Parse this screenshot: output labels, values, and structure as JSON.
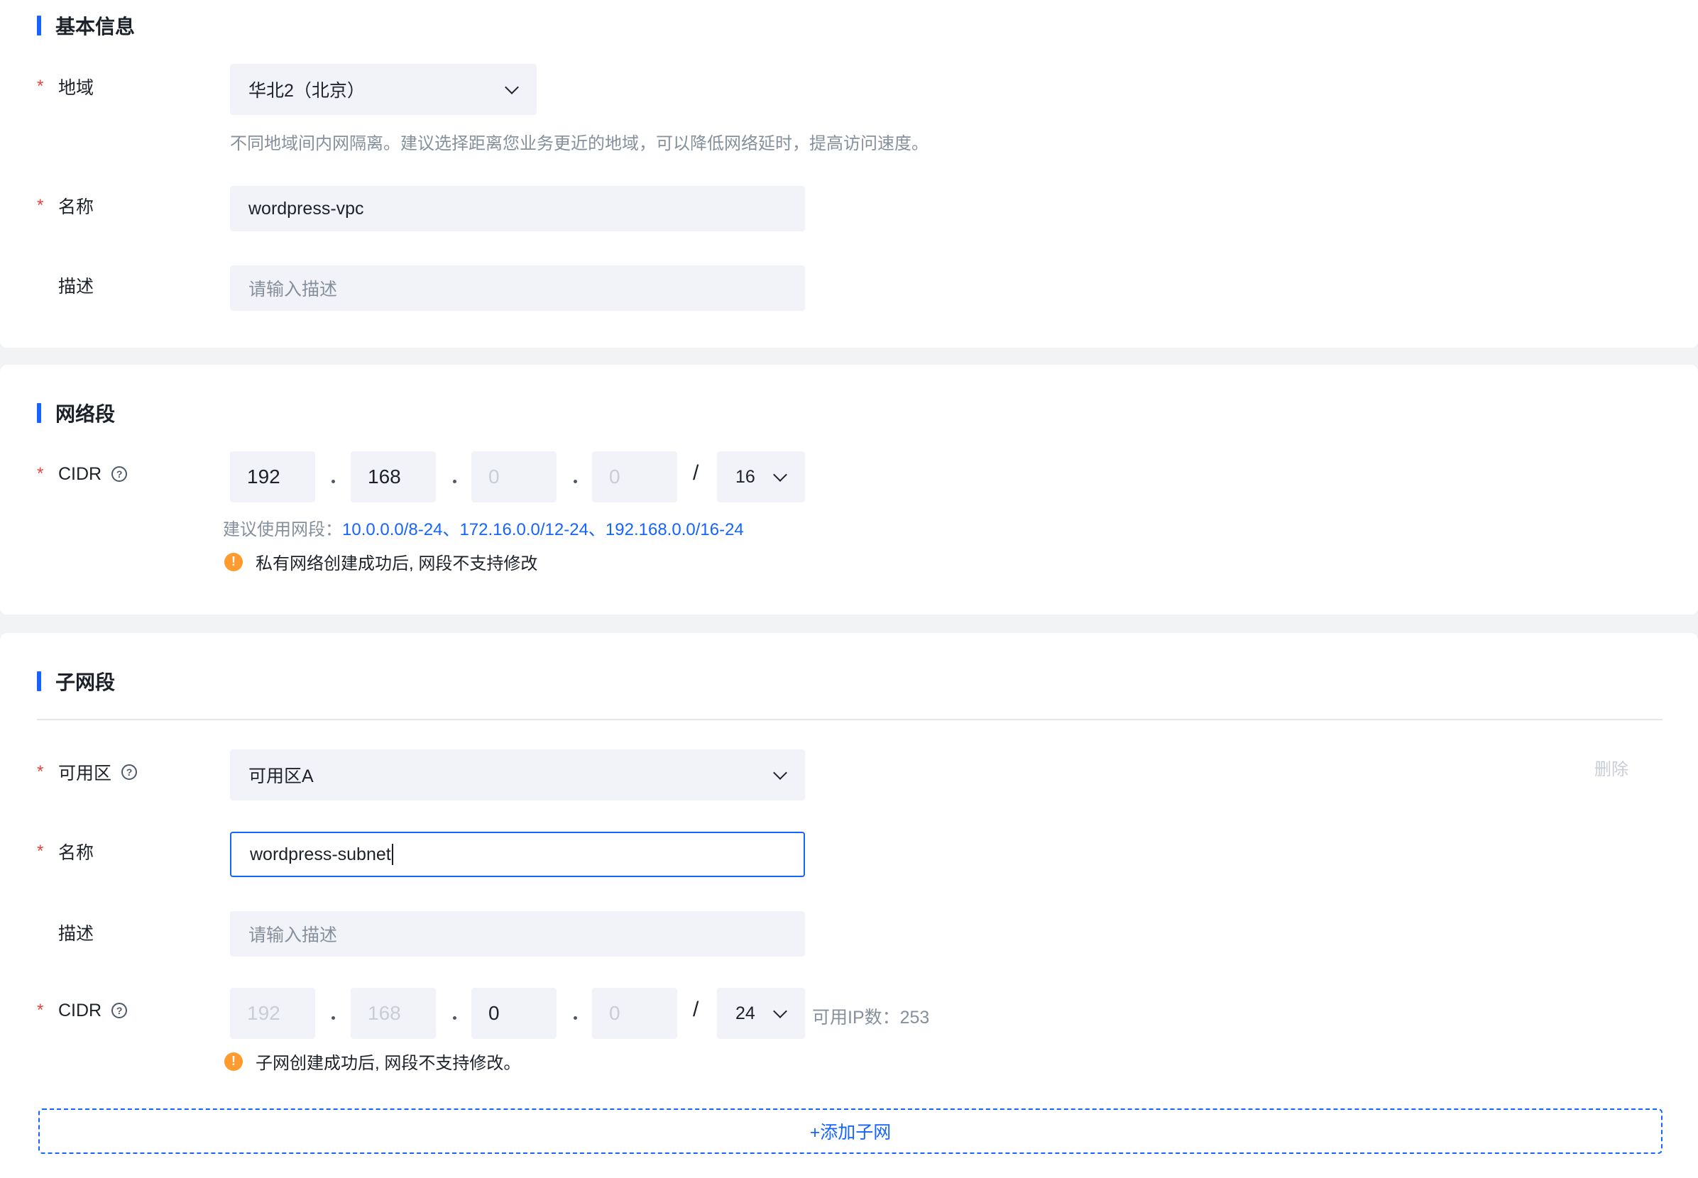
{
  "basic_info": {
    "title": "基本信息",
    "region": {
      "label": "地域",
      "value": "华北2（北京）",
      "hint": "不同地域间内网隔离。建议选择距离您业务更近的地域，可以降低网络延时，提高访问速度。"
    },
    "name": {
      "label": "名称",
      "value": "wordpress-vpc"
    },
    "description": {
      "label": "描述",
      "placeholder": "请输入描述"
    }
  },
  "network": {
    "title": "网络段",
    "cidr": {
      "label": "CIDR",
      "octets": [
        "192",
        "168",
        "0",
        "0"
      ],
      "mask": "16",
      "hint_prefix": "建议使用网段：",
      "hint_ranges": "10.0.0.0/8-24、172.16.0.0/12-24、192.168.0.0/16-24",
      "warning": "私有网络创建成功后, 网段不支持修改"
    }
  },
  "subnet": {
    "title": "子网段",
    "delete_label": "删除",
    "zone": {
      "label": "可用区",
      "value": "可用区A"
    },
    "name": {
      "label": "名称",
      "value": "wordpress-subnet"
    },
    "description": {
      "label": "描述",
      "placeholder": "请输入描述"
    },
    "cidr": {
      "label": "CIDR",
      "octets": [
        "192",
        "168",
        "0",
        "0"
      ],
      "mask": "24",
      "available_ips": "可用IP数：253",
      "warning": "子网创建成功后, 网段不支持修改。"
    },
    "add_button": "+添加子网"
  },
  "symbols": {
    "required": "*",
    "slash": "/",
    "help": "?",
    "warn": "!"
  }
}
